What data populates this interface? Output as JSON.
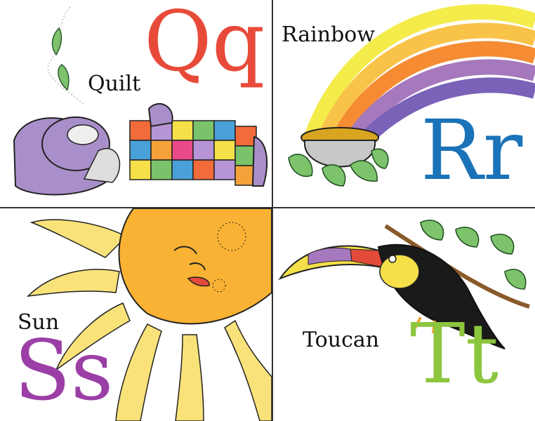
{
  "cards": [
    {
      "letter": "Qq",
      "word": "Quilt",
      "letter_color": "#e84a3a",
      "illustration": "sleeping-person-under-quilt"
    },
    {
      "letter": "Rr",
      "word": "Rainbow",
      "letter_color": "#1a73b8",
      "illustration": "rainbow-and-pot-of-gold"
    },
    {
      "letter": "Ss",
      "word": "Sun",
      "letter_color": "#9b3fa6",
      "illustration": "smiling-sun"
    },
    {
      "letter": "Tt",
      "word": "Toucan",
      "letter_color": "#8cc63e",
      "illustration": "toucan-on-branch"
    }
  ],
  "colors": {
    "rainbow": [
      "#f4ec4a",
      "#f9c34a",
      "#f58b32",
      "#a678bd",
      "#7a62b8"
    ],
    "sun": "#f9b233",
    "quilt_person": "#a98fc9"
  }
}
